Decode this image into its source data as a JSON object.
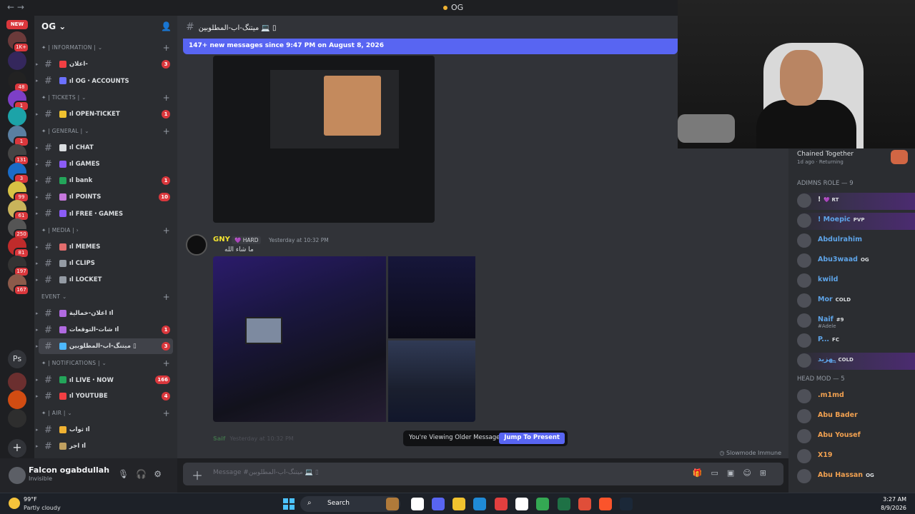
{
  "window": {
    "title": "OG",
    "nav_back": "←",
    "nav_forward": "→"
  },
  "rail": {
    "new_badge": "NEW",
    "ps_label": "Ps",
    "add_label": "+",
    "servers": [
      {
        "badge": "1K+",
        "color": "#6b3a3a"
      },
      {
        "badge": "",
        "color": "#34275c"
      },
      {
        "badge": "48",
        "color": "#222"
      },
      {
        "badge": "1",
        "color": "#7d3fc7"
      },
      {
        "badge": "",
        "color": "#1ca3a8"
      },
      {
        "badge": "1",
        "color": "#5a7fa1"
      },
      {
        "badge": "131",
        "color": "#444"
      },
      {
        "badge": "3",
        "color": "#1a6cc7"
      },
      {
        "badge": "99",
        "color": "#d8c244"
      },
      {
        "badge": "61",
        "color": "#c9b45b"
      },
      {
        "badge": "250",
        "color": "#555"
      },
      {
        "badge": "81",
        "color": "#c02b2b"
      },
      {
        "badge": "197",
        "color": "#333"
      },
      {
        "badge": "167",
        "color": "#8c5a4a"
      },
      {
        "badge": "",
        "color": "#6b2f2f"
      },
      {
        "badge": "",
        "color": "#d14c12"
      },
      {
        "badge": "",
        "color": "#2e2e2e"
      }
    ]
  },
  "server": {
    "name": "OG"
  },
  "sidebar": {
    "categories": [
      {
        "label": "✦ | INFORMATION | ⌄",
        "channels": [
          {
            "name": "اعلان-",
            "count": "3",
            "emo": "#f23f43"
          },
          {
            "name": "ıl OG・ACCOUNTS",
            "count": "",
            "emo": "#6b70ff"
          }
        ]
      },
      {
        "label": "✦ | TICKETS | ⌄",
        "channels": [
          {
            "name": "ıl OPEN-TICKET",
            "count": "1",
            "emo": "#f0c22f"
          }
        ]
      },
      {
        "label": "✦ | GENERAL | ⌄",
        "channels": [
          {
            "name": "ıl CHAT",
            "count": "",
            "emo": "#dbdee1"
          },
          {
            "name": "ıl GAMES",
            "count": "",
            "emo": "#8b5cf6"
          },
          {
            "name": "ıl bank",
            "count": "1",
            "emo": "#23a55a"
          },
          {
            "name": "ıl POINTS",
            "count": "10",
            "emo": "#c678dd"
          },
          {
            "name": "ıl FREE・GAMES",
            "count": "",
            "emo": "#8b5cf6"
          }
        ]
      },
      {
        "label": "✦ | MEDIA | ›",
        "channels": [
          {
            "name": "ıl MEMES",
            "count": "",
            "emo": "#e36d6d"
          },
          {
            "name": "ıl CLIPS",
            "count": "",
            "emo": "#949ba4"
          },
          {
            "name": "ıl LOCKET",
            "count": "",
            "emo": "#949ba4"
          }
        ]
      },
      {
        "label": "Event ⌄",
        "channels": [
          {
            "name": "اعلان-خمالية ıl",
            "count": "",
            "emo": "#b06ae0"
          },
          {
            "name": "شات-التوقعات ıl",
            "count": "1",
            "emo": "#b06ae0"
          },
          {
            "name": "ميتنگ-اب-المطلوبين ▯",
            "count": "3",
            "emo": "#4db8ff",
            "active": true
          }
        ]
      },
      {
        "label": "✦ | NOTIFICATIONS | ⌄",
        "channels": [
          {
            "name": "ıl LIVE・NOW",
            "count": "166",
            "emo": "#23a55a"
          },
          {
            "name": "ıl YOUTUBE",
            "count": "4",
            "emo": "#f23f43"
          }
        ]
      },
      {
        "label": "✦ | AIR | ⌄",
        "channels": [
          {
            "name": "ثواب ıl",
            "count": "",
            "emo": "#f0b232"
          },
          {
            "name": "اجر ıl",
            "count": "",
            "emo": "#c0a060"
          }
        ]
      }
    ]
  },
  "user": {
    "name": "Falcon ogabdullah",
    "status": "Invisible"
  },
  "channel": {
    "title": "ميتنگ-اب-المطلوبين 💻 ▯"
  },
  "main": {
    "new_messages_bar": "147+ new messages since 9:47 PM on August 8, 2026",
    "message": {
      "author": "GNY",
      "tag": "💜 HARD",
      "time": "Yesterday at 10:32 PM",
      "text": "ما شاء الله"
    },
    "ghost": {
      "author": "Saif",
      "time": "Yesterday at 10:32 PM"
    },
    "older_notice": "You're Viewing Older Messages",
    "jump_button": "Jump To Present",
    "slowmode": "Slowmode Immune",
    "composer_placeholder": "Message #ميتنگ-اب-المطلوبين 💻 ▯"
  },
  "members": {
    "activity": {
      "title": "Chained Together",
      "sub": "1d ago · Returning"
    },
    "roles": [
      {
        "title": "ADIMNS ROLE — 9",
        "members": [
          {
            "name": "!",
            "tag": "💜 RT",
            "color": "#dbdee1",
            "hl": true
          },
          {
            "name": "! Moepic",
            "tag": "PVP",
            "color": "#5ea4e8",
            "hl": true
          },
          {
            "name": "Abdulrahim",
            "tag": "",
            "color": "#5ea4e8"
          },
          {
            "name": "Abu3waad",
            "tag": "OG",
            "color": "#5ea4e8"
          },
          {
            "name": "kwild",
            "tag": "",
            "color": "#5ea4e8"
          },
          {
            "name": "Mor",
            "tag": "COLD",
            "color": "#5ea4e8"
          },
          {
            "name": "Naif",
            "tag": "#9",
            "color": "#5ea4e8",
            "sub": "#Adele"
          },
          {
            "name": "P...",
            "tag": "FC",
            "color": "#5ea4e8"
          },
          {
            "name": "ـ͢هزيد",
            "tag": "COLD",
            "color": "#5ea4e8",
            "hl": true
          }
        ]
      },
      {
        "title": "Head Mod — 5",
        "members": [
          {
            "name": ".m1md",
            "tag": "",
            "color": "#f0a050"
          },
          {
            "name": "Abu Bader",
            "tag": "",
            "color": "#f0a050"
          },
          {
            "name": "Abu Yousef",
            "tag": "",
            "color": "#f0a050"
          },
          {
            "name": "X19",
            "tag": "",
            "color": "#f0a050"
          },
          {
            "name": "Abu Hassan",
            "tag": "OG",
            "color": "#f0a050"
          }
        ]
      }
    ]
  },
  "taskbar": {
    "temp": "99°F",
    "condition": "Partly cloudy",
    "search": "Search",
    "time": "3:27 AM",
    "date": "8/9/2026",
    "icons": [
      "#b07a3a",
      "#ffffff",
      "#5865f2",
      "#f0c22f",
      "#1f8ad6",
      "#e23f3f",
      "#ffffff",
      "#34a853",
      "#1e7145",
      "#e04e39",
      "#fb542b",
      "#1b2838"
    ]
  }
}
